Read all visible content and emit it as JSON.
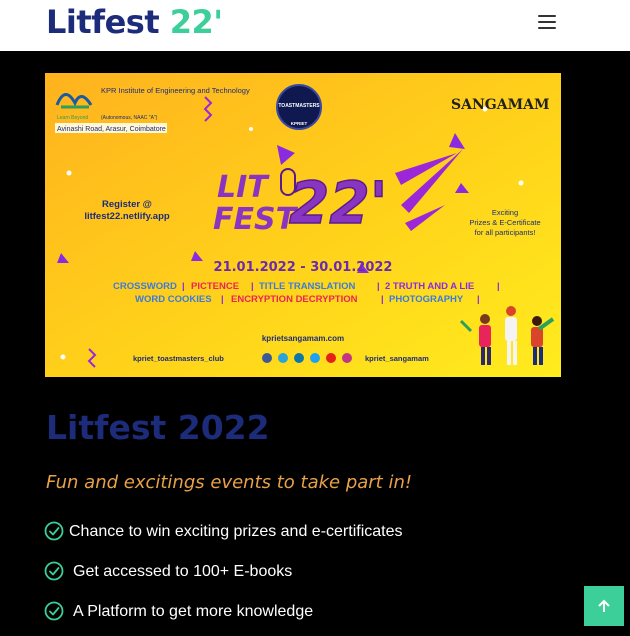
{
  "navbar": {
    "brand_part1": "Litfest",
    "brand_part2": "22'",
    "menu_icon": "hamburger-menu-icon"
  },
  "poster": {
    "college_name": "KPR Institute of Engineering and Technology",
    "college_tag1": "Learn Beyond",
    "college_tag2": "(Autonomous, NAAC \"A\")",
    "college_address": "Avinashi Road, Arasur, Coimbatore",
    "club_badge": "TOASTMASTERS",
    "club_sub": "KPRIET",
    "partner": "SANGAMAM",
    "register_line1": "Register @",
    "register_line2": "litfest22.netlify.app",
    "headline_lit": "LIT",
    "headline_fest": "FEST",
    "headline_year": "22'",
    "exciting_line1": "Exciting",
    "exciting_line2": "Prizes & E-Certificate",
    "exciting_line3": "for all participants!",
    "dates": "21.01.2022 - 30.01.2022",
    "events_row1": [
      "CROSSWORD",
      "PICTENCE",
      "TITLE TRANSLATION",
      "2 TRUTH AND A LIE"
    ],
    "events_row2": [
      "WORD COOKIES",
      "ENCRYPTION DECRYPTION",
      "PHOTOGRAPHY"
    ],
    "website": "kprietsangamam.com",
    "handle_left": "kpriet_toastmasters_club",
    "handle_right": "kpriet_sangamam"
  },
  "main": {
    "title": "Litfest 2022",
    "subtitle": "Fun and excitings events to take part in!",
    "features": [
      "Chance to win exciting prizes and e-certificates",
      "Get accessed to 100+ E-books",
      "A Platform to get more knowledge"
    ]
  },
  "colors": {
    "brand_dark": "#1c2c7a",
    "brand_accent": "#3ccf9a",
    "subtitle": "#e8a14a",
    "background": "#000000"
  },
  "back_to_top_icon": "arrow-up-icon"
}
